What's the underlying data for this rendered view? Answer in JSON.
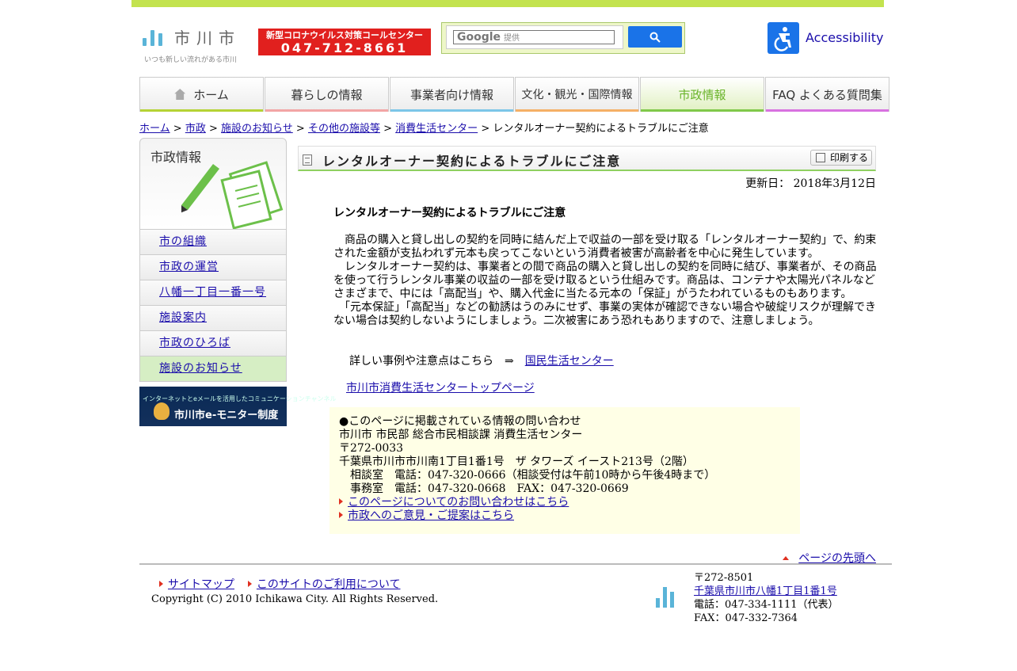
{
  "header": {
    "logo_name": "市川市",
    "logo_tagline": "いつも新しい流れがある市川",
    "corona_line1": "新型コロナウイルス対策コールセンター",
    "corona_phone": "047-712-8661",
    "search_google": "Google",
    "search_placeholder": "提供",
    "accessibility": "Accessibility"
  },
  "nav": [
    {
      "label": "ホーム",
      "color": "#b5d335"
    },
    {
      "label": "暮らしの情報",
      "color": "#f2a5a5"
    },
    {
      "label": "事業者向け情報",
      "color": "#7cc6e8"
    },
    {
      "label": "文化・観光・国際情報",
      "color": "#f5b066"
    },
    {
      "label": "市政情報",
      "color": "#80c94a"
    },
    {
      "label": "FAQ よくある質問集",
      "color": "#d872e0"
    }
  ],
  "breadcrumb": {
    "items": [
      "ホーム",
      "市政",
      "施設のお知らせ",
      "その他の施設等",
      "消費生活センター"
    ],
    "current": "レンタルオーナー契約によるトラブルにご注意",
    "sep": ">"
  },
  "sidebar": {
    "title": "市政情報",
    "items": [
      "市の組織",
      "市政の運営",
      "八幡一丁目一番一号",
      "施設案内",
      "市政のひろば",
      "施設のお知らせ"
    ],
    "banner_small": "インターネットとeメールを活用したコミュニケーションチャンネル",
    "banner_big": "市川市e-モニター制度"
  },
  "page": {
    "title": "レンタルオーナー契約によるトラブルにご注意",
    "print": "印刷する",
    "updated": "更新日： 2018年3月12日",
    "heading": "レンタルオーナー契約によるトラブルにご注意",
    "para1": "　商品の購入と貸し出しの契約を同時に結んだ上で収益の一部を受け取る「レンタルオーナー契約」で、約束された金額が支払われず元本も戻ってこないという消費者被害が高齢者を中心に発生しています。",
    "para2": "　レンタルオーナー契約は、事業者との間で商品の購入と貸し出しの契約を同時に結び、事業者が、その商品を使って行うレンタル事業の収益の一部を受け取るという仕組みです。商品は、コンテナや太陽光パネルなどさまざまで、中には「高配当」や、購入代金に当たる元本の「保証」がうたわれているものもあります。",
    "para3": "　「元本保証」「高配当」などの勧誘はうのみにせず、事業の実体が確認できない場合や破綻リスクが理解できない場合は契約しないようにしましょう。二次被害にあう恐れもありますので、注意しましょう。",
    "detail_text": "詳しい事例や注意点はこちら　⇒　",
    "detail_link": "国民生活センター",
    "top_link": "市川市消費生活センタートップページ"
  },
  "contact": {
    "heading": "●このページに掲載されている情報の問い合わせ",
    "dept": "市川市 市民部 総合市民相談課 消費生活センター",
    "zip": "〒272-0033",
    "address": "千葉県市川市市川南1丁目1番1号　ザ タワーズ イースト213号（2階）",
    "tel1": "相談室　電話：047-320-0666（相談受付は午前10時から午後4時まで）",
    "tel2": "事務室　電話：047-320-0668　FAX：047-320-0669",
    "link1": "このページについてのお問い合わせはこちら",
    "link2": "市政へのご意見・ご提案はこちら"
  },
  "totop": "ページの先頭へ",
  "footer": {
    "sitemap": "サイトマップ",
    "usage": "このサイトのご利用について",
    "copyright": "Copyright (C) 2010 Ichikawa City. All Rights Reserved.",
    "zip": "〒272-8501",
    "address": "千葉県市川市八幡1丁目1番1号",
    "tel": "電話：047-334-1111（代表）",
    "fax": "FAX：047-332-7364"
  }
}
